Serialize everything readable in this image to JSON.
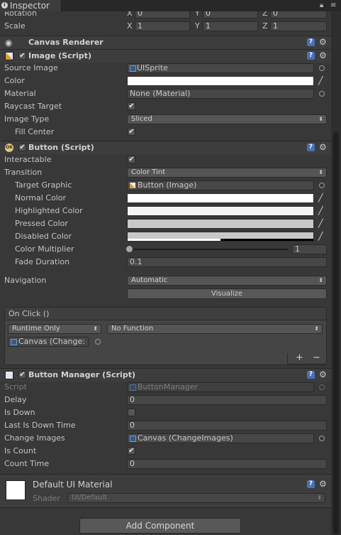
{
  "window": {
    "tab_title": "Inspector",
    "tab_icon": "info-icon",
    "lock_icon": "lock-icon",
    "menu_icon": "menu-icon"
  },
  "transform": {
    "rotation": {
      "label": "Rotation",
      "x": "0",
      "y": "0",
      "z": "0"
    },
    "scale": {
      "label": "Scale",
      "x": "1",
      "y": "1",
      "z": "1"
    },
    "axis_x": "X",
    "axis_y": "Y",
    "axis_z": "Z"
  },
  "canvas_renderer": {
    "title": "Canvas Renderer"
  },
  "image_component": {
    "title": "Image (Script)",
    "enabled": true,
    "source_image": {
      "label": "Source Image",
      "value": "UISprite"
    },
    "color": {
      "label": "Color",
      "value": "#ffffff"
    },
    "material": {
      "label": "Material",
      "value": "None (Material)"
    },
    "raycast_target": {
      "label": "Raycast Target",
      "checked": true
    },
    "image_type": {
      "label": "Image Type",
      "value": "Sliced"
    },
    "fill_center": {
      "label": "Fill Center",
      "checked": true
    }
  },
  "button_component": {
    "title": "Button (Script)",
    "icon_text": "OK",
    "enabled": true,
    "interactable": {
      "label": "Interactable",
      "checked": true
    },
    "transition": {
      "label": "Transition",
      "value": "Color Tint"
    },
    "target_graphic": {
      "label": "Target Graphic",
      "value": "Button (Image)"
    },
    "normal_color": {
      "label": "Normal Color",
      "value": "#ffffff"
    },
    "highlighted_color": {
      "label": "Highlighted Color",
      "value": "#f5f5f5"
    },
    "pressed_color": {
      "label": "Pressed Color",
      "value": "#c8c8c8"
    },
    "disabled_color": {
      "label": "Disabled Color",
      "value": "#c8c8c8",
      "alpha": 0.5
    },
    "color_multiplier": {
      "label": "Color Multiplier",
      "value": "1",
      "slider_fraction": 0.0
    },
    "fade_duration": {
      "label": "Fade Duration",
      "value": "0.1"
    },
    "navigation": {
      "label": "Navigation",
      "value": "Automatic"
    },
    "visualize": {
      "label": "Visualize"
    },
    "on_click": {
      "title": "On Click ()",
      "runtime": "Runtime Only",
      "function": "No Function",
      "object": "Canvas (Change:",
      "plus": "+",
      "minus": "−"
    }
  },
  "button_manager": {
    "title": "Button Manager (Script)",
    "enabled": true,
    "script": {
      "label": "Script",
      "value": "ButtonManager"
    },
    "delay": {
      "label": "Delay",
      "value": "0"
    },
    "is_down": {
      "label": "Is Down",
      "checked": false
    },
    "last_is_down_time": {
      "label": "Last Is Down Time",
      "value": "0"
    },
    "change_images": {
      "label": "Change Images",
      "value": "Canvas (ChangeImages)"
    },
    "is_count": {
      "label": "Is Count",
      "checked": true
    },
    "count_time": {
      "label": "Count Time",
      "value": "0"
    }
  },
  "material_section": {
    "name": "Default UI Material",
    "shader_label": "Shader",
    "shader_value": "UI/Default"
  },
  "add_component": {
    "label": "Add Component"
  },
  "colors": {
    "panel_bg": "#383838",
    "header_bg": "#3d3d3d",
    "field_bg": "#474747",
    "help_blue": "#4a6fb5",
    "text": "#c4c4c4"
  }
}
